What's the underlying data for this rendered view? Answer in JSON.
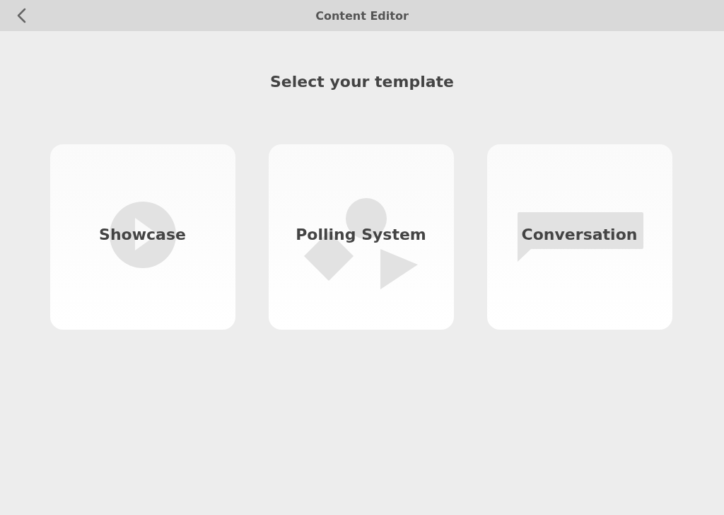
{
  "header": {
    "title": "Content Editor"
  },
  "heading": "Select your template",
  "templates": [
    {
      "kind": "showcase",
      "label": "Showcase"
    },
    {
      "kind": "polling",
      "label": "Polling System"
    },
    {
      "kind": "conversation",
      "label": "Conversation"
    }
  ]
}
